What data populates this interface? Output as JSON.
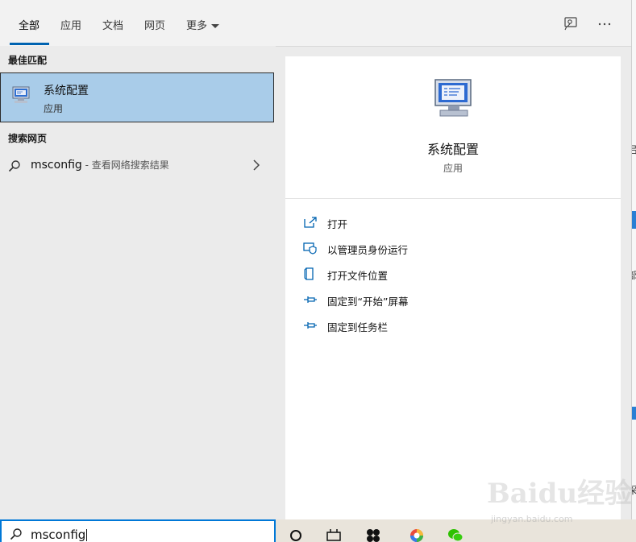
{
  "tabs": [
    {
      "label": "全部",
      "active": true
    },
    {
      "label": "应用"
    },
    {
      "label": "文档"
    },
    {
      "label": "网页"
    },
    {
      "label": "更多"
    }
  ],
  "toolbar": {
    "feedback_icon": "feedback-icon",
    "more_icon": "ellipsis-icon"
  },
  "best_match": {
    "header": "最佳匹配",
    "title": "系统配置",
    "subtitle": "应用"
  },
  "web": {
    "header": "搜索网页",
    "query": "msconfig",
    "description": " - 查看网络搜索结果"
  },
  "detail": {
    "title": "系统配置",
    "subtitle": "应用",
    "actions": [
      {
        "label": "打开",
        "icon": "open-icon"
      },
      {
        "label": "以管理员身份运行",
        "icon": "shield-icon"
      },
      {
        "label": "打开文件位置",
        "icon": "file-location-icon"
      },
      {
        "label": "固定到“开始”屏幕",
        "icon": "pin-icon"
      },
      {
        "label": "固定到任务栏",
        "icon": "pin-icon"
      }
    ]
  },
  "search": {
    "value": "msconfig"
  },
  "background": {
    "text1": "吕",
    "text2": "部",
    "text3": "采"
  },
  "watermark": {
    "brand": "Baidu经验",
    "url": "jingyan.baidu.com"
  },
  "colors": {
    "accent": "#0078d7",
    "selection": "#a9cce9",
    "tab_underline": "#0063b1"
  }
}
